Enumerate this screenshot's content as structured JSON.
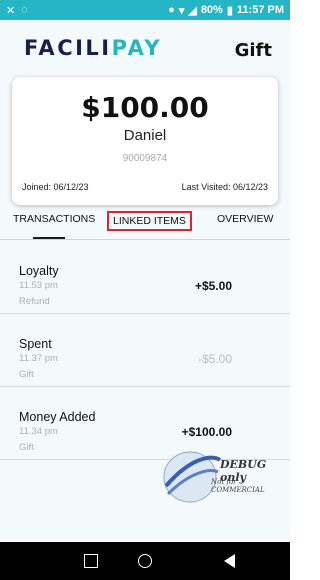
{
  "status_bar": {
    "battery_percent": "80%",
    "time": "11:57 PM"
  },
  "header": {
    "logo_part1": "FACILI",
    "logo_part2": "PAY",
    "title": "Gift"
  },
  "card": {
    "balance": "$100.00",
    "holder_name": "Daniel",
    "card_number": "90009874",
    "joined": "Joined: 06/12/23",
    "last_visited": "Last Visited: 06/12/23"
  },
  "tabs": [
    {
      "label": "TRANSACTIONS"
    },
    {
      "label": "LINKED ITEMS"
    },
    {
      "label": "OVERVIEW"
    }
  ],
  "transactions": [
    {
      "title": "Loyalty",
      "time": "11.53 pm",
      "type": "Refund",
      "amount": "+$5.00"
    },
    {
      "title": "Spent",
      "time": "11.37 pm",
      "type": "Gift",
      "amount": "-$5.00"
    },
    {
      "title": "Money Added",
      "time": "11.34 pm",
      "type": "Gift",
      "amount": "+$100.00"
    }
  ],
  "watermark": {
    "line1": "DEBUG only",
    "line2": "Not for COMMERCIAL"
  },
  "colors": {
    "status_bar": "#25b5c4",
    "logo_dark": "#16204a",
    "logo_accent": "#25b5c4",
    "highlight_box": "#d8262f"
  }
}
